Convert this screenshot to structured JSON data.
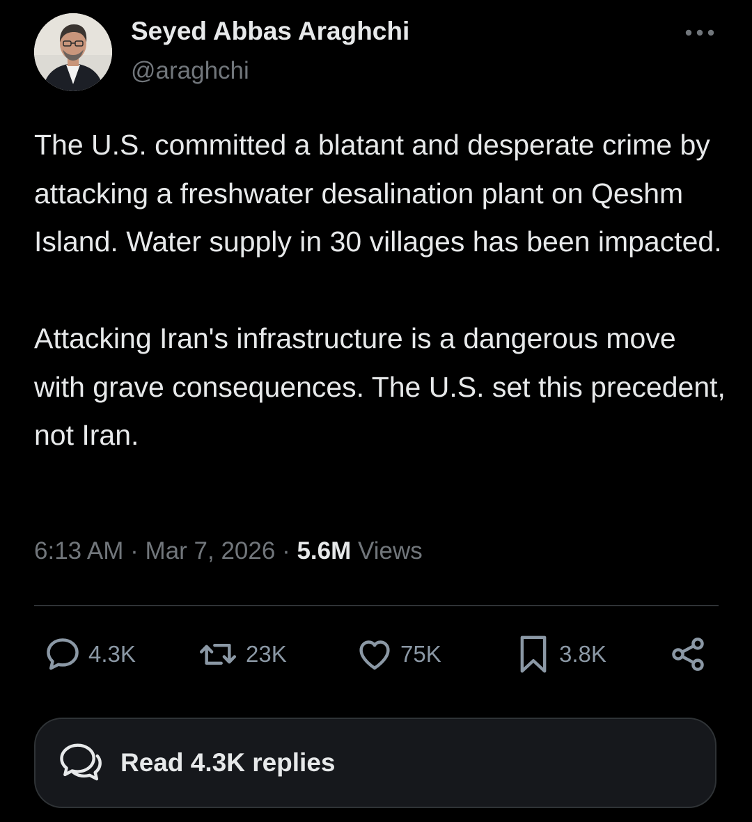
{
  "author": {
    "display_name": "Seyed Abbas Araghchi",
    "handle": "@araghchi"
  },
  "tweet": {
    "paragraphs": [
      "The U.S. committed a blatant and desperate crime by attacking a freshwater desalination plant on Qeshm Island. Water supply in 30 villages has been impacted.",
      "Attacking Iran's infrastructure is a dangerous move with grave consequences. The U.S. set this precedent, not Iran."
    ],
    "time": "6:13 AM",
    "separator": "·",
    "date": "Mar 7, 2026",
    "views_count": "5.6M",
    "views_label": "Views"
  },
  "actions": {
    "reply": {
      "icon": "reply-icon",
      "count": "4.3K"
    },
    "retweet": {
      "icon": "retweet-icon",
      "count": "23K"
    },
    "like": {
      "icon": "heart-icon",
      "count": "75K"
    },
    "bookmark": {
      "icon": "bookmark-icon",
      "count": "3.8K"
    },
    "share": {
      "icon": "share-icon"
    }
  },
  "read_replies": {
    "label": "Read 4.3K replies",
    "icon": "replies-bubble-icon"
  },
  "colors": {
    "background": "#000000",
    "primary_text": "#e7e9ea",
    "secondary_text": "#71767b",
    "action_text": "#8b98a5",
    "divider": "#2f3336",
    "button_background": "#16181c"
  }
}
